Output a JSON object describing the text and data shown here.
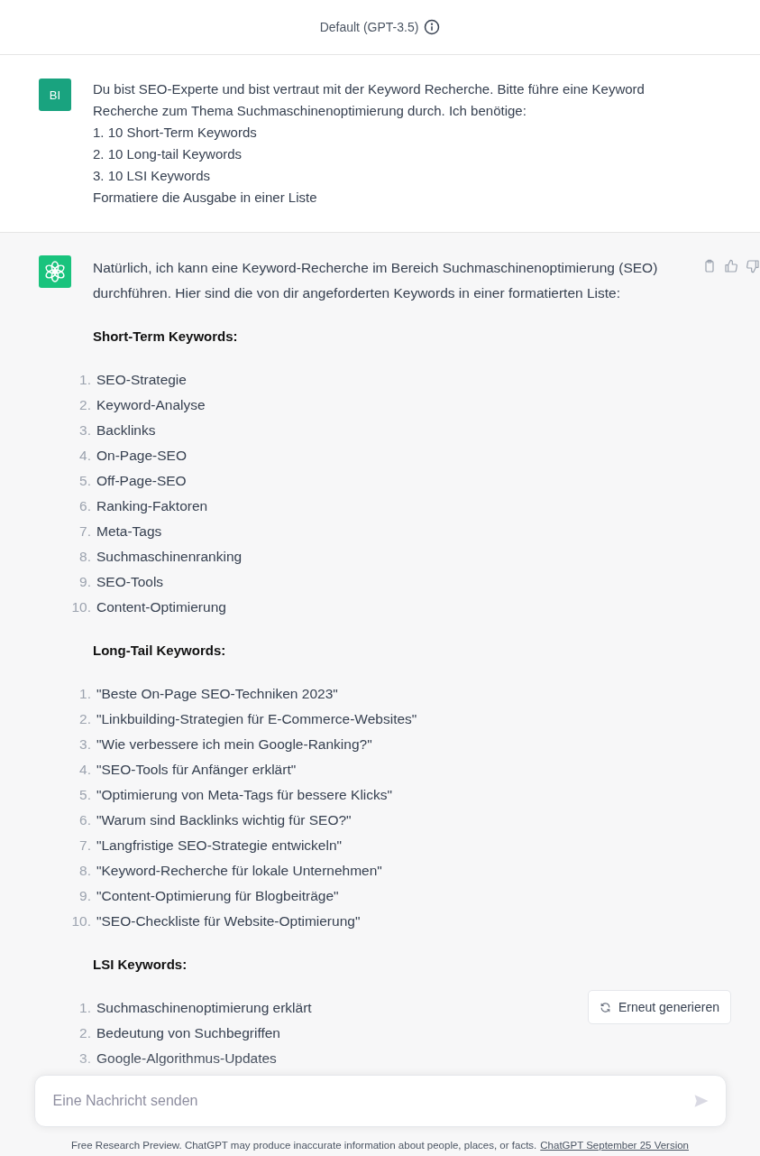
{
  "header": {
    "model": "Default (GPT-3.5)"
  },
  "user_message": {
    "avatar": "BI",
    "lines": [
      "Du bist SEO-Experte und bist vertraut mit der Keyword Recherche. Bitte führe eine Keyword Recherche zum Thema Suchmaschinenoptimierung durch. Ich benötige:",
      "1. 10 Short-Term Keywords",
      "2. 10 Long-tail Keywords",
      "3. 10 LSI Keywords",
      "Formatiere die Ausgabe in einer Liste"
    ]
  },
  "assistant_message": {
    "intro": "Natürlich, ich kann eine Keyword-Recherche im Bereich Suchmaschinenoptimierung (SEO) durchführen. Hier sind die von dir angeforderten Keywords in einer formatierten Liste:",
    "sections": [
      {
        "heading": "Short-Term Keywords:",
        "items": [
          {
            "number": "1.",
            "text": "SEO-Strategie"
          },
          {
            "number": "2.",
            "text": "Keyword-Analyse"
          },
          {
            "number": "3.",
            "text": "Backlinks"
          },
          {
            "number": "4.",
            "text": "On-Page-SEO"
          },
          {
            "number": "5.",
            "text": "Off-Page-SEO"
          },
          {
            "number": "6.",
            "text": "Ranking-Faktoren"
          },
          {
            "number": "7.",
            "text": "Meta-Tags"
          },
          {
            "number": "8.",
            "text": "Suchmaschinenranking"
          },
          {
            "number": "9.",
            "text": "SEO-Tools"
          },
          {
            "number": "10.",
            "text": "Content-Optimierung"
          }
        ]
      },
      {
        "heading": "Long-Tail Keywords:",
        "items": [
          {
            "number": "1.",
            "text": "\"Beste On-Page SEO-Techniken 2023\""
          },
          {
            "number": "2.",
            "text": "\"Linkbuilding-Strategien für E-Commerce-Websites\""
          },
          {
            "number": "3.",
            "text": "\"Wie verbessere ich mein Google-Ranking?\""
          },
          {
            "number": "4.",
            "text": "\"SEO-Tools für Anfänger erklärt\""
          },
          {
            "number": "5.",
            "text": "\"Optimierung von Meta-Tags für bessere Klicks\""
          },
          {
            "number": "6.",
            "text": "\"Warum sind Backlinks wichtig für SEO?\""
          },
          {
            "number": "7.",
            "text": "\"Langfristige SEO-Strategie entwickeln\""
          },
          {
            "number": "8.",
            "text": "\"Keyword-Recherche für lokale Unternehmen\""
          },
          {
            "number": "9.",
            "text": "\"Content-Optimierung für Blogbeiträge\""
          },
          {
            "number": "10.",
            "text": "\"SEO-Checkliste für Website-Optimierung\""
          }
        ]
      },
      {
        "heading": "LSI Keywords:",
        "items": [
          {
            "number": "1.",
            "text": "Suchmaschinenoptimierung erklärt"
          },
          {
            "number": "2.",
            "text": "Bedeutung von Suchbegriffen"
          },
          {
            "number": "3.",
            "text": "Google-Algorithmus-Updates"
          }
        ]
      }
    ]
  },
  "regenerate_button": "Erneut generieren",
  "composer": {
    "placeholder": "Eine Nachricht senden"
  },
  "footer": {
    "text": "Free Research Preview. ChatGPT may produce inaccurate information about people, places, or facts.",
    "link": "ChatGPT September 25 Version"
  }
}
